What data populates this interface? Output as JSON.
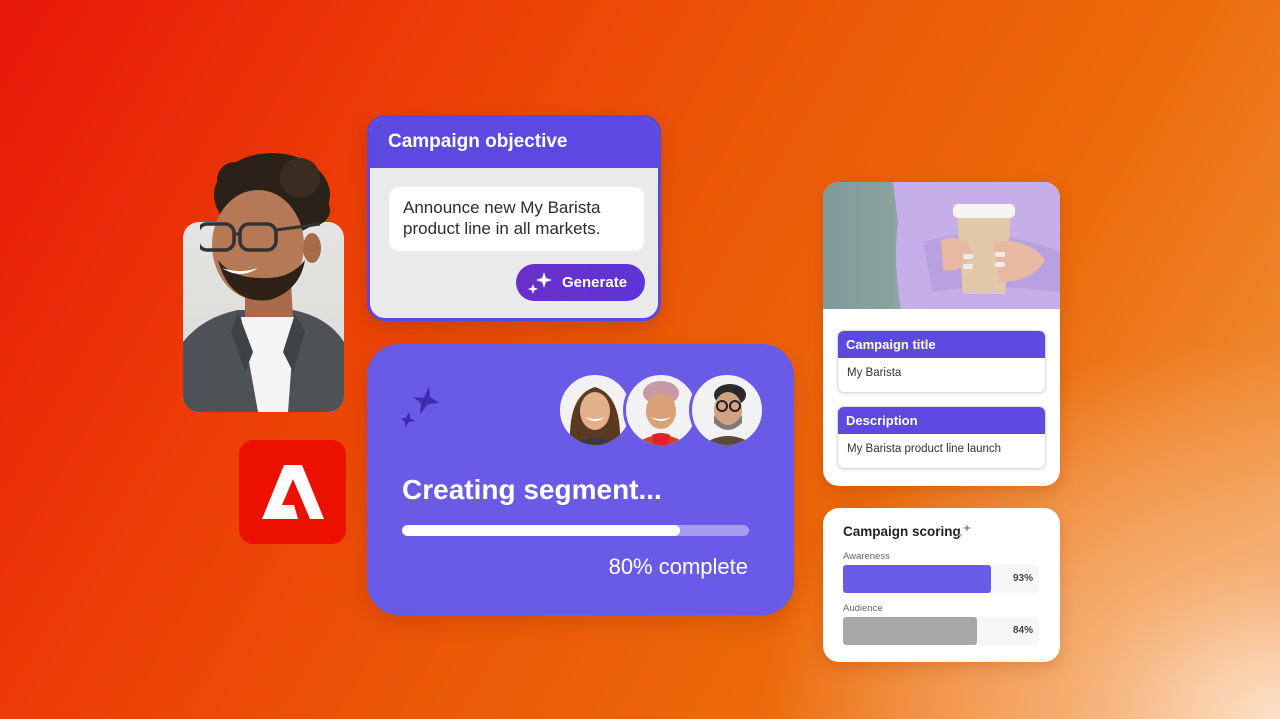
{
  "brand": {
    "logo": "adobe-logo",
    "accent": "#5c49e0",
    "logo_color": "#eb1000"
  },
  "objective_card": {
    "title": "Campaign objective",
    "input_value": "Announce new My Barista product line in all markets.",
    "generate_label": "Generate",
    "generate_icon": "sparkle-icon"
  },
  "segment_card": {
    "title": "Creating segment...",
    "progress": 0.8,
    "progress_label": "80% complete",
    "icon": "sparkle-icon",
    "avatars": [
      "woman-curly-hair",
      "woman-short-hair",
      "man-glasses-beard"
    ]
  },
  "detail_card": {
    "photo": "hands-holding-coffee-cup",
    "fields": [
      {
        "label": "Campaign title",
        "value": "My Barista"
      },
      {
        "label": "Description",
        "value": "My Barista product line launch"
      }
    ]
  },
  "scoring_card": {
    "title": "Campaign scoring",
    "icon": "sparkle-icon",
    "metrics": [
      {
        "label": "Awareness",
        "value": 93,
        "display": "93%",
        "color": "#6a5be6"
      },
      {
        "label": "Audience",
        "value": 84,
        "display": "84%",
        "color": "#a8a8a8"
      }
    ]
  },
  "person_photo": "smiling-man-glasses"
}
